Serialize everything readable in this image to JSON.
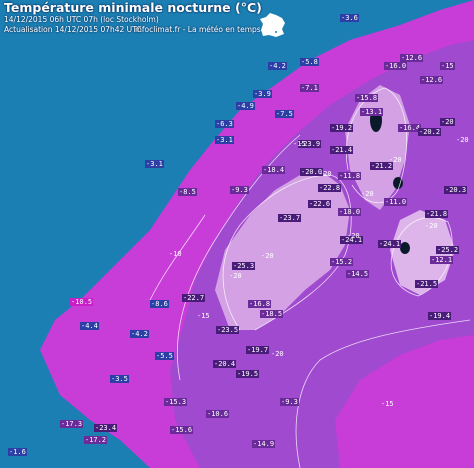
{
  "header": {
    "title": "Température minimale nocturne (°C)",
    "line1": "14/12/2015  06h UTC  07h (loc Stockholm)",
    "line2": "Actualisation 14/12/2015 07h42 UTC",
    "line2_right": "infoclimat.fr - La météo en temps réel"
  },
  "colors": {
    "sea": "#1b7fb3",
    "coast_land": "#c83cd8",
    "interior_cold": "#a04ad0",
    "very_cold": "#e7c6ee",
    "lakes": "#0a1a2a"
  },
  "station_labels": [
    {
      "text": "-3.6",
      "t": "sea"
    },
    {
      "text": "-12.6",
      "t": "cold"
    },
    {
      "text": "-16.0",
      "t": "cold"
    },
    {
      "text": "-15",
      "t": "cold"
    },
    {
      "text": "-5.8",
      "t": "sea"
    },
    {
      "text": "-4.2",
      "t": "sea"
    },
    {
      "text": "-3.9",
      "t": "sea"
    },
    {
      "text": "-4.9",
      "t": "sea"
    },
    {
      "text": "-7.1",
      "t": "cold"
    },
    {
      "text": "-15.8",
      "t": "cold"
    },
    {
      "text": "-19.2",
      "t": "vcold"
    },
    {
      "text": "-12.6",
      "t": "cold"
    },
    {
      "text": "-3.1",
      "t": "sea"
    },
    {
      "text": "-6.3",
      "t": "sea"
    },
    {
      "text": "-7.5",
      "t": "sea"
    },
    {
      "text": "-13.1",
      "t": "cold"
    },
    {
      "text": "-16.4",
      "t": "cold"
    },
    {
      "text": "-20.2",
      "t": "vcold"
    },
    {
      "text": "-20",
      "t": "vcold"
    },
    {
      "text": "-3.1",
      "t": "sea"
    },
    {
      "text": "-23.9",
      "t": "vcold"
    },
    {
      "text": "-21.4",
      "t": "vcold"
    },
    {
      "text": "-21.2",
      "t": "vcold"
    },
    {
      "text": "-18.4",
      "t": "cold"
    },
    {
      "text": "-11.8",
      "t": "cold"
    },
    {
      "text": "-20.0",
      "t": "vcold"
    },
    {
      "text": "-22.8",
      "t": "vcold"
    },
    {
      "text": "-11.0",
      "t": "cold"
    },
    {
      "text": "-9.3",
      "t": "cold"
    },
    {
      "text": "-8.5",
      "t": "cold"
    },
    {
      "text": "-23.7",
      "t": "vcold"
    },
    {
      "text": "-22.6",
      "t": "vcold"
    },
    {
      "text": "-18.0",
      "t": "cold"
    },
    {
      "text": "-24.1",
      "t": "vcold"
    },
    {
      "text": "-20.3",
      "t": "vcold"
    },
    {
      "text": "-21.8",
      "t": "vcold"
    },
    {
      "text": "-24.1",
      "t": "vcold"
    },
    {
      "text": "-25.2",
      "t": "vcold"
    },
    {
      "text": "-12.1",
      "t": "cold"
    },
    {
      "text": "-15.2",
      "t": "cold"
    },
    {
      "text": "-25.3",
      "t": "vcold"
    },
    {
      "text": "-14.5",
      "t": "cold"
    },
    {
      "text": "-22.7",
      "t": "vcold"
    },
    {
      "text": "-16.8",
      "t": "cold"
    },
    {
      "text": "-18.5",
      "t": "cold"
    },
    {
      "text": "-21.5",
      "t": "vcold"
    },
    {
      "text": "-19.4",
      "t": "vcold"
    },
    {
      "text": "-10.5",
      "t": "mag"
    },
    {
      "text": "-8.6",
      "t": "sea"
    },
    {
      "text": "-23.5",
      "t": "vcold"
    },
    {
      "text": "-19.7",
      "t": "vcold"
    },
    {
      "text": "-20.4",
      "t": "vcold"
    },
    {
      "text": "-19.5",
      "t": "vcold"
    },
    {
      "text": "-4.4",
      "t": "sea"
    },
    {
      "text": "-5.5",
      "t": "sea"
    },
    {
      "text": "-4.2",
      "t": "sea"
    },
    {
      "text": "-3.5",
      "t": "sea"
    },
    {
      "text": "-10.6",
      "t": "cold"
    },
    {
      "text": "-15.3",
      "t": "cold"
    },
    {
      "text": "-15.6",
      "t": "cold"
    },
    {
      "text": "-9.3",
      "t": "cold"
    },
    {
      "text": "-17.2",
      "t": "cold"
    },
    {
      "text": "-23.4",
      "t": "vcold"
    },
    {
      "text": "-1.6",
      "t": "sea"
    },
    {
      "text": "-14.9",
      "t": "cold"
    },
    {
      "text": "-17.3",
      "t": "cold"
    }
  ],
  "isotherm_labels": [
    "-20",
    "-20",
    "-20",
    "-20",
    "-15",
    "-10",
    "-15",
    "-20",
    "-20",
    "-20",
    "-20",
    "-15",
    "-20"
  ]
}
